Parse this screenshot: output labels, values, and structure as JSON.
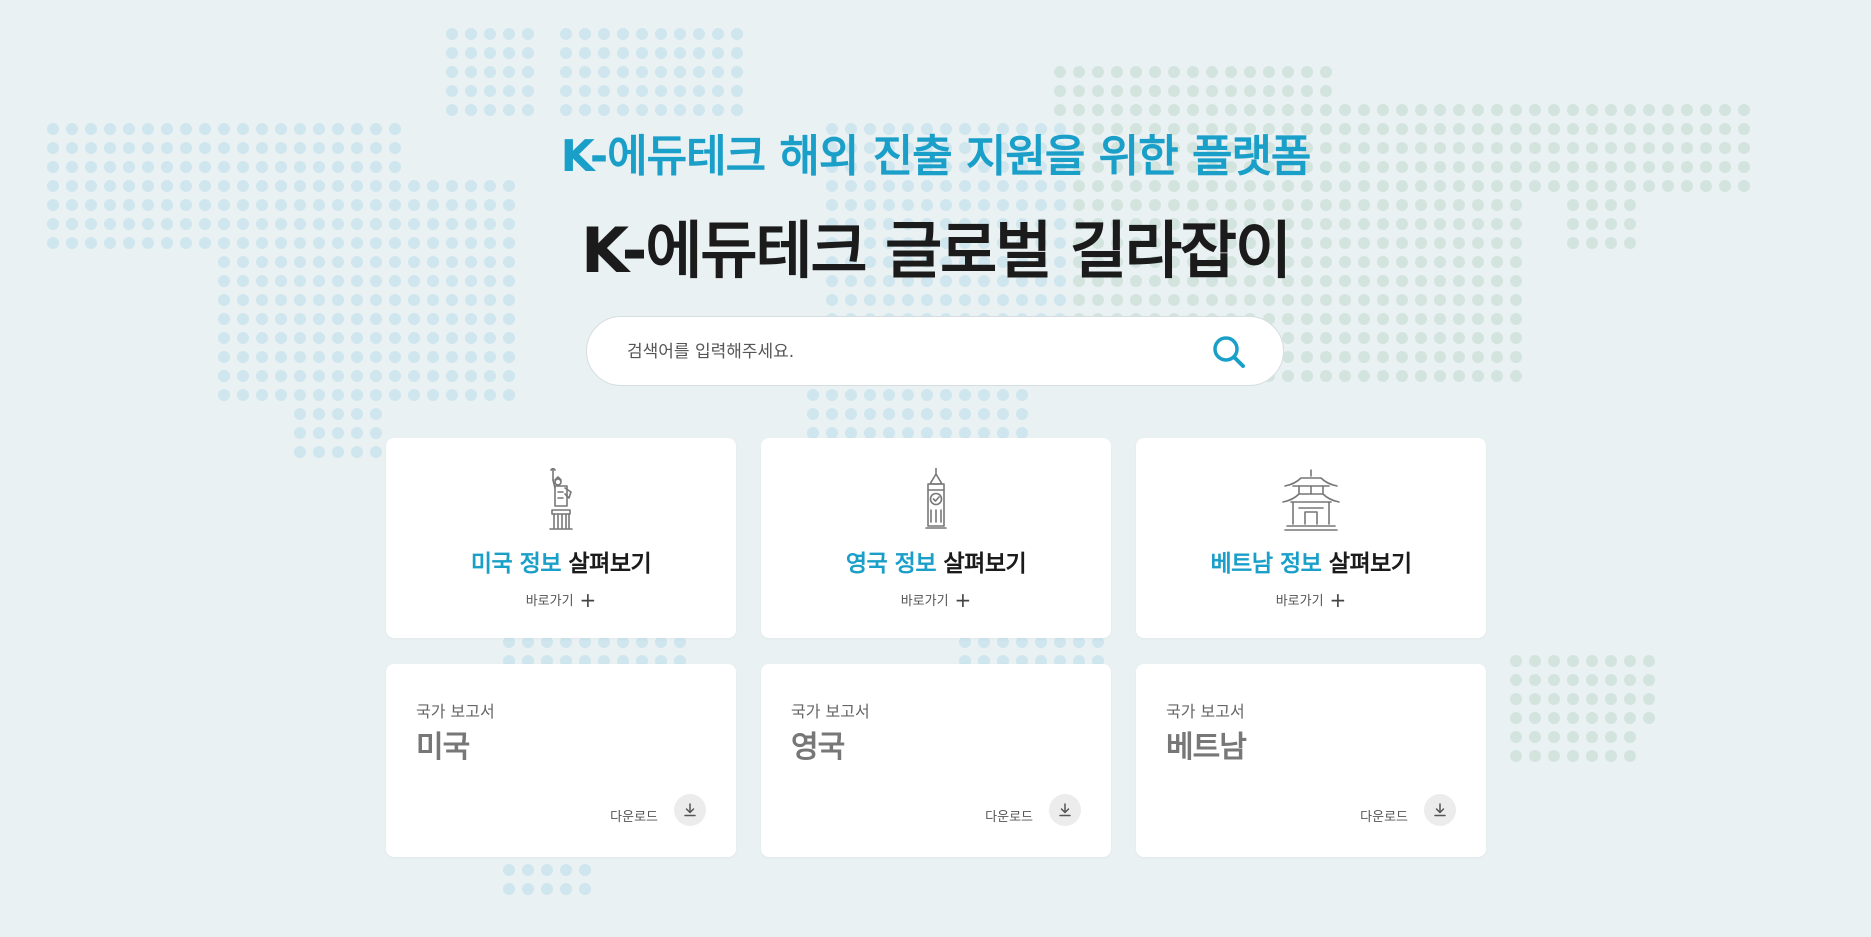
{
  "hero": {
    "subtitle": "K-에듀테크 해외 진출 지원을 위한 플랫폼",
    "title": "K-에듀테크 글로벌 길라잡이"
  },
  "search": {
    "placeholder": "검색어를 입력해주세요."
  },
  "info_cards": [
    {
      "highlight": "미국 정보",
      "rest": " 살펴보기",
      "link": "바로가기",
      "icon": "statue-of-liberty-icon"
    },
    {
      "highlight": "영국 정보",
      "rest": " 살펴보기",
      "link": "바로가기",
      "icon": "big-ben-icon"
    },
    {
      "highlight": "베트남 정보",
      "rest": " 살펴보기",
      "link": "바로가기",
      "icon": "pagoda-icon"
    }
  ],
  "report_cards": [
    {
      "label": "국가 보고서",
      "country": "미국",
      "download": "다운로드"
    },
    {
      "label": "국가 보고서",
      "country": "영국",
      "download": "다운로드"
    },
    {
      "label": "국가 보고서",
      "country": "베트남",
      "download": "다운로드"
    }
  ],
  "colors": {
    "accent": "#1a9fc9",
    "background": "#e9f1f3",
    "map_dot_blue": "#cfe6ee",
    "map_dot_green": "#d3e4df"
  },
  "icons": [
    "search-icon",
    "plus-icon",
    "download-icon",
    "statue-of-liberty-icon",
    "big-ben-icon",
    "pagoda-icon"
  ]
}
